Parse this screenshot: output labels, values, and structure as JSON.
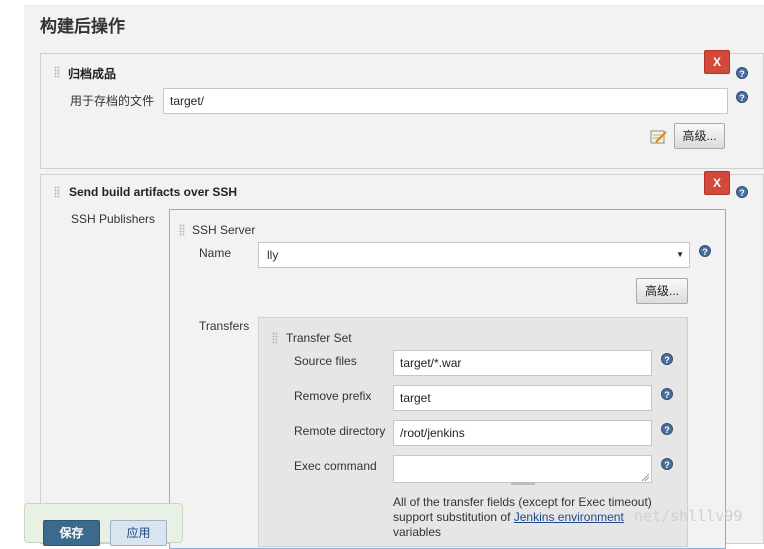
{
  "section": {
    "title": "构建后操作"
  },
  "archive": {
    "title": "归档成品",
    "files_label": "用于存档的文件",
    "files_value": "target/",
    "advanced_label": "高级...",
    "delete_label": "X"
  },
  "ssh": {
    "title": "Send build artifacts over SSH",
    "delete_label": "X",
    "publishers_label": "SSH Publishers",
    "server": {
      "title": "SSH Server",
      "name_label": "Name",
      "name_value": "lly",
      "advanced_label": "高级..."
    },
    "transfers_label": "Transfers",
    "transfer_set": {
      "title": "Transfer Set",
      "source_files_label": "Source files",
      "source_files_value": "target/*.war",
      "remove_prefix_label": "Remove prefix",
      "remove_prefix_value": "target",
      "remote_directory_label": "Remote directory",
      "remote_directory_value": "/root/jenkins",
      "exec_command_label": "Exec command",
      "exec_command_value": "",
      "note_part1": "All of the transfer fields (except for Exec timeout)",
      "note_part2": "support substitution of",
      "note_link": "Jenkins environment",
      "note_part3": "variables"
    }
  },
  "footer": {
    "save_label": "保存",
    "apply_label": "应用"
  },
  "watermark": "net/shlllv99",
  "help_glyph": "?",
  "select_caret": "▼",
  "colors": {
    "danger": "#d24939",
    "primary": "#3b6a8c",
    "help": "#4a6f9b",
    "link": "#204a87"
  }
}
